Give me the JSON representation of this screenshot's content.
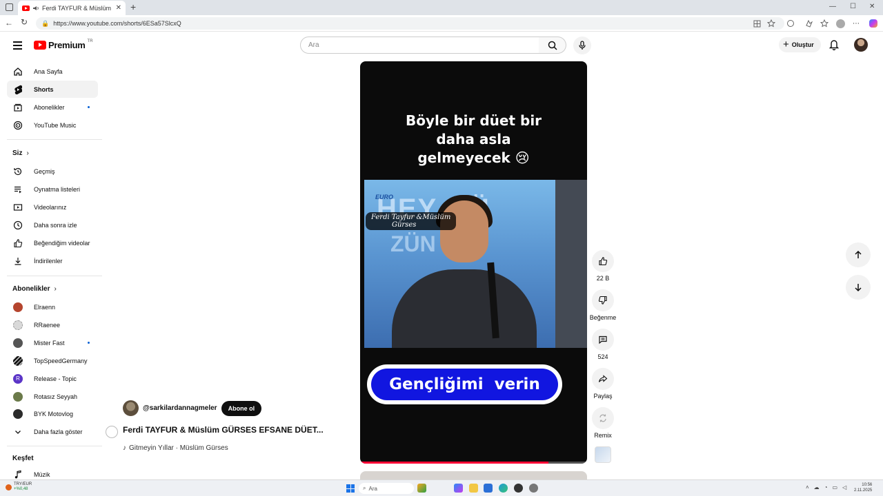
{
  "browser": {
    "tab_title": "Ferdi TAYFUR & Müslüm GÜ",
    "url": "https://www.youtube.com/shorts/6ESa57SlcxQ"
  },
  "masthead": {
    "logo_text": "Premium",
    "logo_region": "TR",
    "search_placeholder": "Ara",
    "create_label": "Oluştur"
  },
  "sidebar": {
    "main": [
      {
        "label": "Ana Sayfa",
        "icon": "home-icon"
      },
      {
        "label": "Shorts",
        "icon": "shorts-icon",
        "active": true
      },
      {
        "label": "Abonelikler",
        "icon": "subscriptions-icon",
        "dot": true
      },
      {
        "label": "YouTube Music",
        "icon": "youtube-music-icon"
      }
    ],
    "you_title": "Siz",
    "you": [
      {
        "label": "Geçmiş",
        "icon": "history-icon"
      },
      {
        "label": "Oynatma listeleri",
        "icon": "playlists-icon"
      },
      {
        "label": "Videolarınız",
        "icon": "your-videos-icon"
      },
      {
        "label": "Daha sonra izle",
        "icon": "watch-later-icon"
      },
      {
        "label": "Beğendiğim videolar",
        "icon": "liked-videos-icon"
      },
      {
        "label": "İndirilenler",
        "icon": "downloads-icon"
      }
    ],
    "subs_title": "Abonelikler",
    "subs": [
      {
        "label": "Elraenn",
        "color": "#b5452e"
      },
      {
        "label": "RRaenee",
        "color": "#d9d9d9"
      },
      {
        "label": "Mister Fast",
        "color": "#555555",
        "dot": true
      },
      {
        "label": "TopSpeedGermany",
        "color": "#1a1a1a"
      },
      {
        "label": "Release - Topic",
        "color": "#5b35c7",
        "letter": "R"
      },
      {
        "label": "Rotasız Seyyah",
        "color": "#6b7a4a"
      },
      {
        "label": "BYK Motovlog",
        "color": "#2b2b2b"
      }
    ],
    "show_more": "Daha fazla göster",
    "explore_title": "Keşfet",
    "explore": [
      {
        "label": "Müzik",
        "icon": "music-icon"
      }
    ]
  },
  "video": {
    "caption_top": [
      "Böyle bir düet  bir",
      "daha asla",
      "gelmeyecek 😢"
    ],
    "scene_label": [
      "Ferdi Tayfur &Müslüm",
      "Gürses"
    ],
    "scene_sign": "HEY GÜ",
    "scene_sign2": "ZÜN",
    "scene_logo": "EURO",
    "caption_bottom": "Gençliğimi  verin",
    "progress": 0.83
  },
  "actions": {
    "like_count": "22 B",
    "dislike_label": "Beğenme",
    "comment_count": "524",
    "share_label": "Paylaş",
    "remix_label": "Remix"
  },
  "short_info": {
    "channel": "@sarkilardannagmeler",
    "subscribe_label": "Abone ol",
    "title": "Ferdi TAYFUR & Müslüm GÜRSES EFSANE DÜET...",
    "music": "Gitmeyin Yıllar · Müslüm Gürses"
  },
  "taskbar": {
    "ticker_symbol": "TRY/EUR",
    "ticker_change": "+%0,48",
    "search_label": "Ara",
    "time": "10:56",
    "date": "2.11.2025"
  },
  "colors": {
    "accent_red": "#ff0000",
    "caption_blue": "#1116e0",
    "progress_red": "#ff0033"
  }
}
